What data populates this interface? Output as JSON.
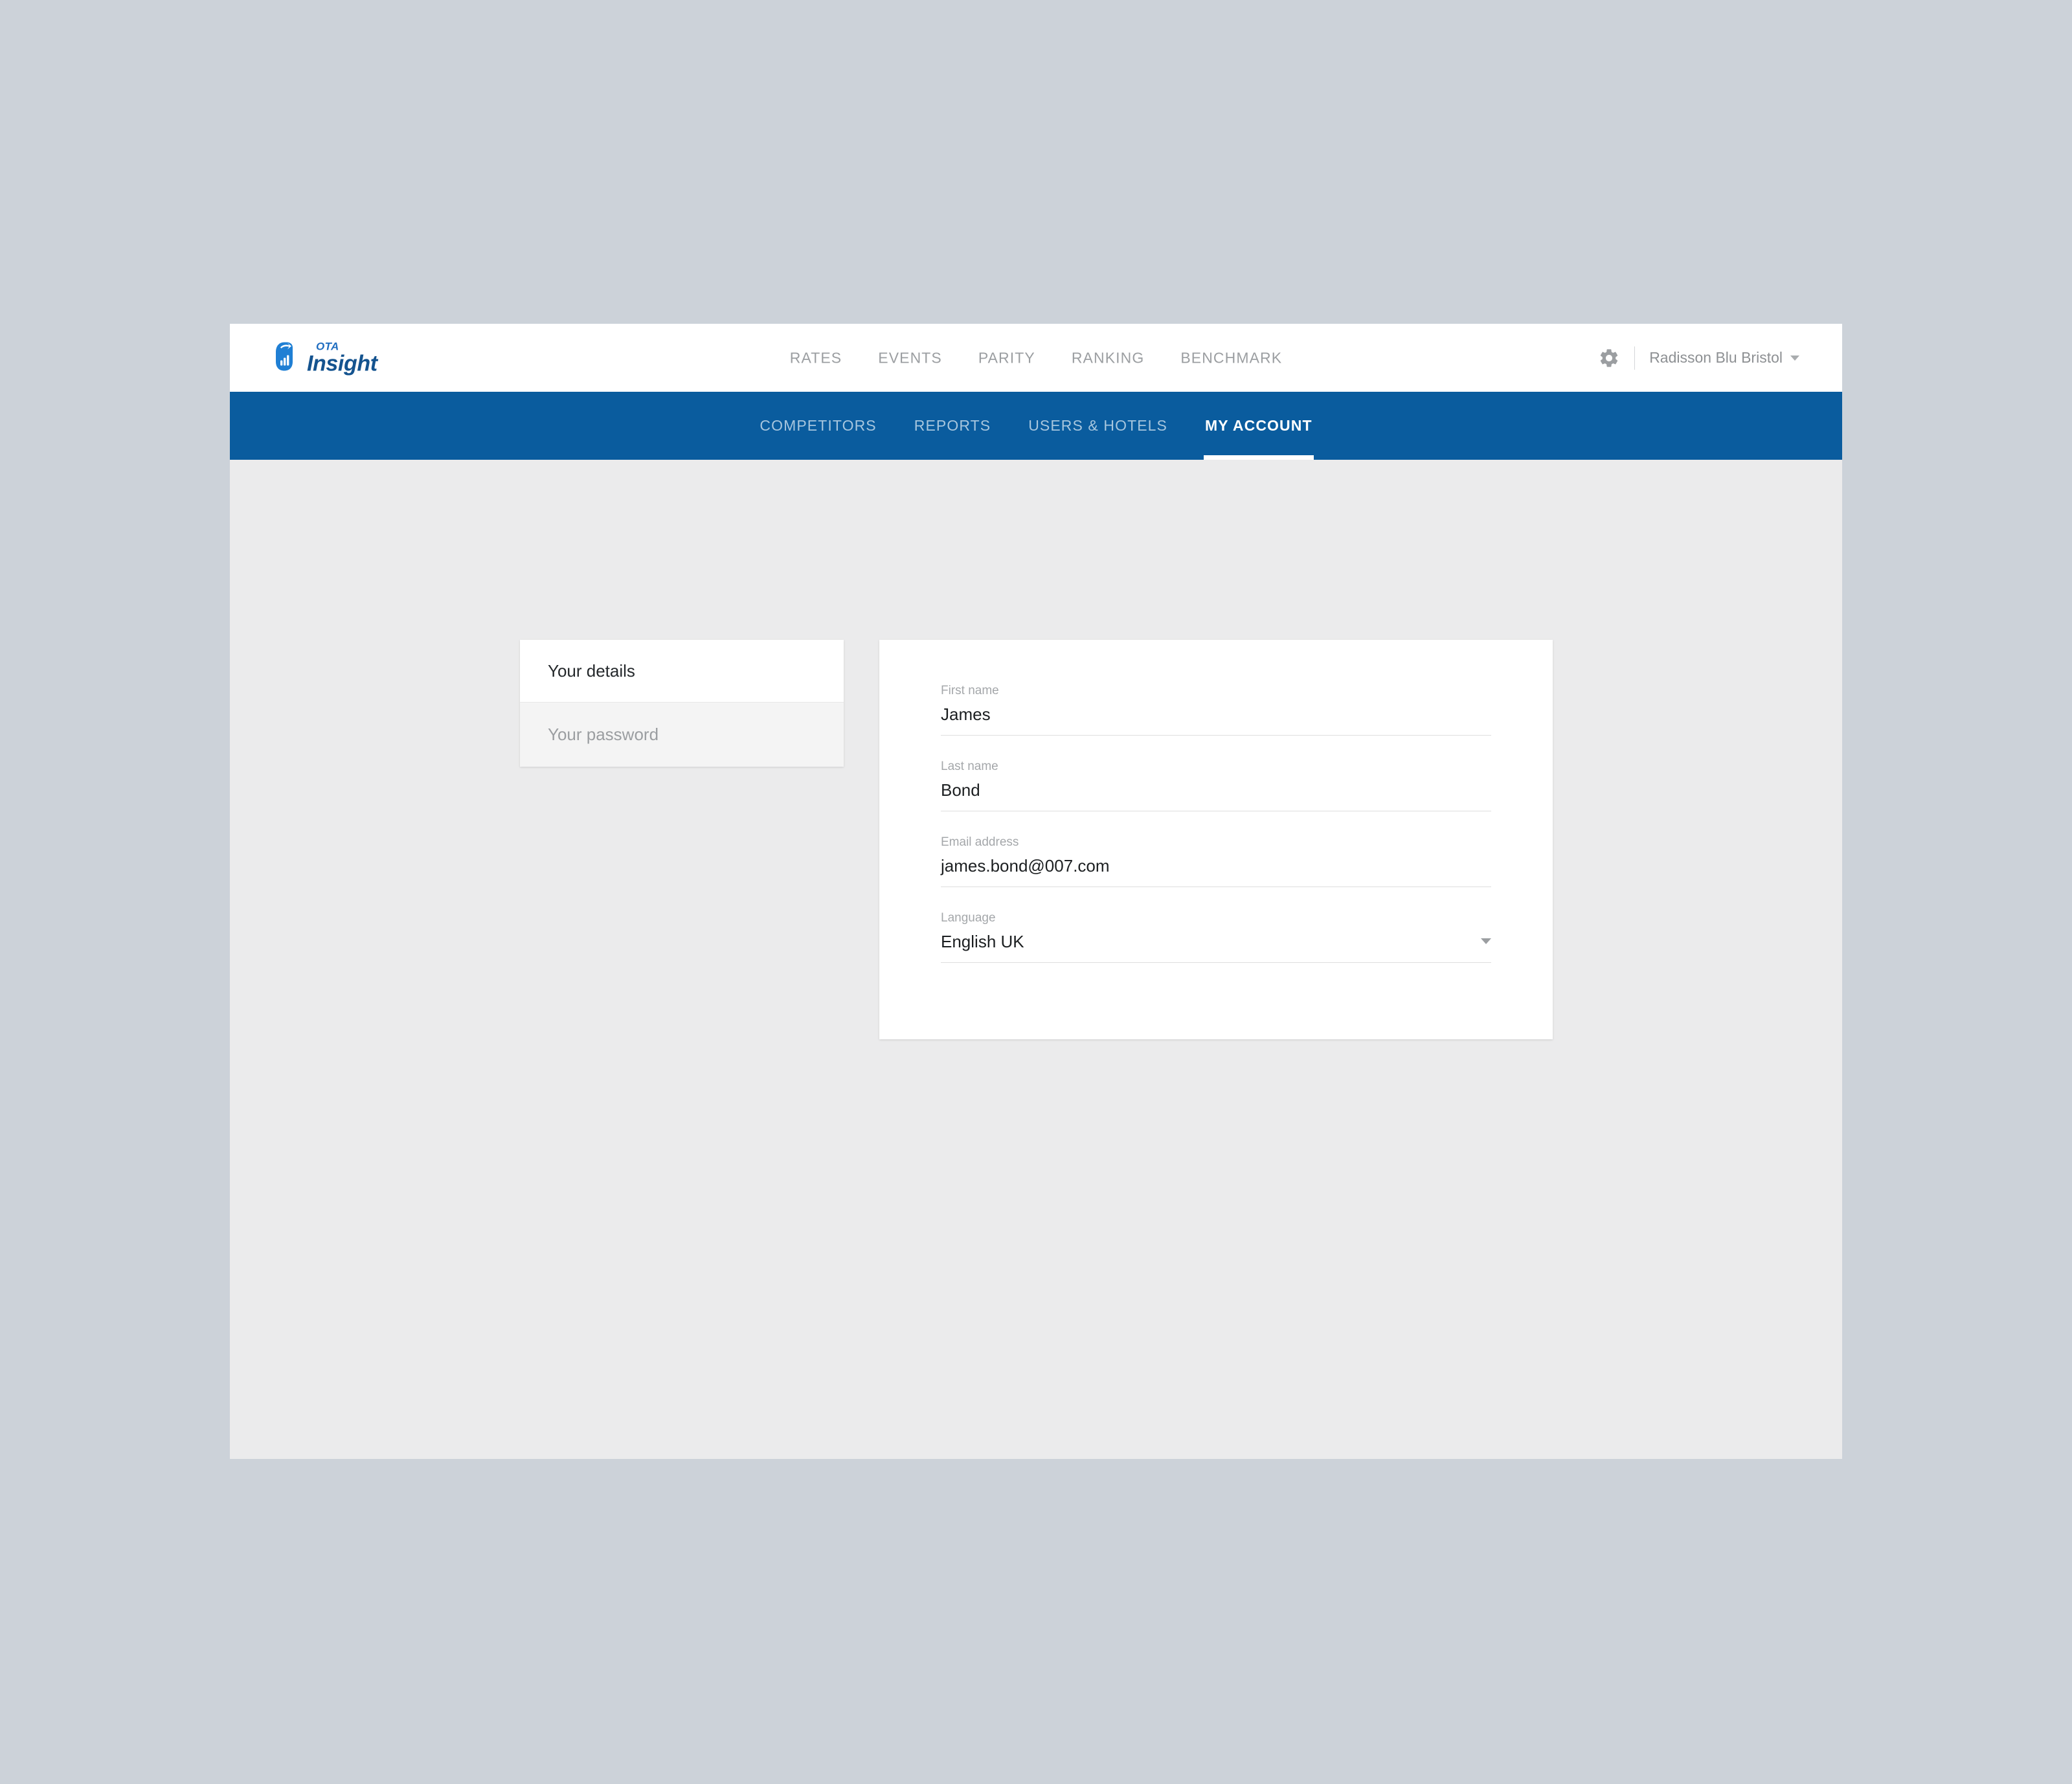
{
  "header": {
    "logo": {
      "mark_icon": "ota-insight-mark-icon",
      "ota_text": "OTA",
      "insight_text": "Insight"
    },
    "nav_items": [
      {
        "label": "RATES"
      },
      {
        "label": "EVENTS"
      },
      {
        "label": "PARITY"
      },
      {
        "label": "RANKING"
      },
      {
        "label": "BENCHMARK"
      }
    ],
    "settings_icon": "gear-icon",
    "hotel_selector": {
      "name": "Radisson Blu Bristol",
      "caret_icon": "chevron-down-icon"
    }
  },
  "sub_nav": {
    "items": [
      {
        "label": "COMPETITORS",
        "active": false
      },
      {
        "label": "REPORTS",
        "active": false
      },
      {
        "label": "USERS & HOTELS",
        "active": false
      },
      {
        "label": "MY ACCOUNT",
        "active": true
      }
    ]
  },
  "settings_menu": {
    "items": [
      {
        "label": "Your details",
        "active": true
      },
      {
        "label": "Your password",
        "active": false
      }
    ]
  },
  "details_form": {
    "fields": [
      {
        "label": "First name",
        "value": "James"
      },
      {
        "label": "Last name",
        "value": "Bond"
      },
      {
        "label": "Email address",
        "value": "james.bond@007.com"
      },
      {
        "label": "Language",
        "value": "English UK",
        "caret_icon": "chevron-down-icon"
      }
    ]
  },
  "colors": {
    "desktop_background": "#ccd2d9",
    "brand_blue": "#0a5c9e",
    "content_background": "#ebebec",
    "card_background": "#ffffff",
    "muted_text": "#9b9ea1",
    "logo_blue": "#1f6dc0",
    "logo_dark_blue": "#14538f"
  }
}
